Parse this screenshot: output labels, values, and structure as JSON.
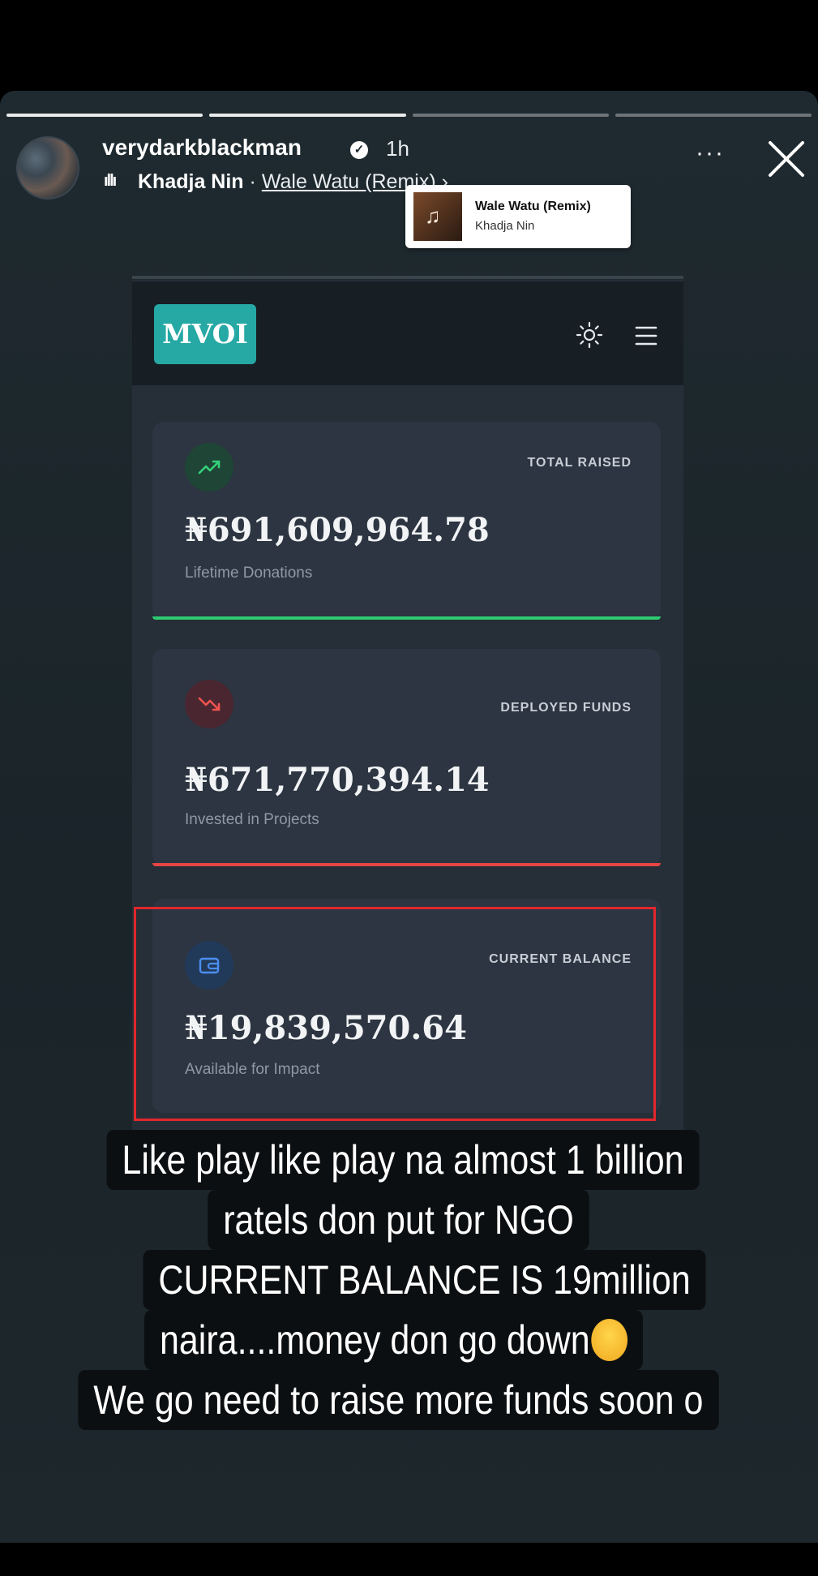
{
  "story": {
    "username": "verydarkblackman",
    "time_ago": "1h",
    "music_artist": "Khadja Nin",
    "music_separator": "·",
    "music_title": "Wale Watu (Remix)",
    "music_chevron": "›",
    "more_label": "···"
  },
  "sticker": {
    "title": "Wale Watu (Remix)",
    "artist": "Khadja Nin"
  },
  "app": {
    "logo": "MVOI"
  },
  "cards": [
    {
      "label": "TOTAL RAISED",
      "amount": "₦691,609,964.78",
      "sub": "Lifetime Donations",
      "accent": "#2ecc71",
      "icon": "trending-up-icon"
    },
    {
      "label": "DEPLOYED FUNDS",
      "amount": "₦671,770,394.14",
      "sub": "Invested in Projects",
      "accent": "#e84545",
      "icon": "trending-down-icon"
    },
    {
      "label": "CURRENT BALANCE",
      "amount": "₦19,839,570.64",
      "sub": "Available for Impact",
      "accent": "#3b82f6",
      "icon": "wallet-icon"
    }
  ],
  "caption": [
    "Like play like play na almost 1 billion",
    "ratels don put for NGO",
    "CURRENT BALANCE IS 19million",
    "naira....money don go down",
    "We go need to raise more funds soon o"
  ]
}
